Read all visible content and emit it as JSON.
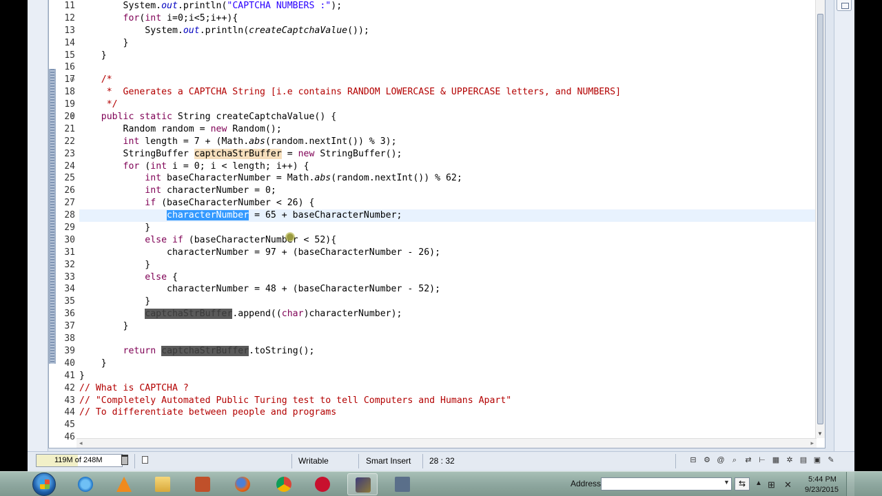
{
  "editor": {
    "lines": [
      {
        "n": "11",
        "fold": ""
      },
      {
        "n": "12",
        "fold": ""
      },
      {
        "n": "13",
        "fold": ""
      },
      {
        "n": "14",
        "fold": ""
      },
      {
        "n": "15",
        "fold": ""
      },
      {
        "n": "16",
        "fold": ""
      },
      {
        "n": "17",
        "fold": "⊖"
      },
      {
        "n": "18",
        "fold": ""
      },
      {
        "n": "19",
        "fold": ""
      },
      {
        "n": "20",
        "fold": "⊖"
      },
      {
        "n": "21",
        "fold": ""
      },
      {
        "n": "22",
        "fold": ""
      },
      {
        "n": "23",
        "fold": ""
      },
      {
        "n": "24",
        "fold": ""
      },
      {
        "n": "25",
        "fold": ""
      },
      {
        "n": "26",
        "fold": ""
      },
      {
        "n": "27",
        "fold": ""
      },
      {
        "n": "28",
        "fold": ""
      },
      {
        "n": "29",
        "fold": ""
      },
      {
        "n": "30",
        "fold": ""
      },
      {
        "n": "31",
        "fold": ""
      },
      {
        "n": "32",
        "fold": ""
      },
      {
        "n": "33",
        "fold": ""
      },
      {
        "n": "34",
        "fold": ""
      },
      {
        "n": "35",
        "fold": ""
      },
      {
        "n": "36",
        "fold": ""
      },
      {
        "n": "37",
        "fold": ""
      },
      {
        "n": "38",
        "fold": ""
      },
      {
        "n": "39",
        "fold": ""
      },
      {
        "n": "40",
        "fold": ""
      },
      {
        "n": "41",
        "fold": ""
      },
      {
        "n": "42",
        "fold": ""
      },
      {
        "n": "43",
        "fold": ""
      },
      {
        "n": "44",
        "fold": ""
      },
      {
        "n": "45",
        "fold": ""
      },
      {
        "n": "46",
        "fold": ""
      }
    ],
    "current_line": "28",
    "code": {
      "l11_a": "        System.",
      "l11_b": "out",
      "l11_c": ".println(",
      "l11_d": "\"CAPTCHA NUMBERS :\"",
      "l11_e": ");",
      "l12_a": "        ",
      "l12_kw": "for",
      "l12_b": "(",
      "l12_kw2": "int",
      "l12_c": " i=0;i<5;i++){",
      "l13_a": "            System.",
      "l13_b": "out",
      "l13_c": ".println(",
      "l13_d": "createCaptchaValue",
      "l13_e": "());",
      "l14": "        }",
      "l15": "    }",
      "l16": "",
      "l17": "    /*",
      "l18": "     *  Generates a CAPTCHA String [i.e contains RANDOM LOWERCASE & UPPERCASE letters, and NUMBERS]",
      "l19": "     */",
      "l20_a": "    ",
      "l20_kw": "public static",
      "l20_b": " String createCaptchaValue() {",
      "l21_a": "        Random random = ",
      "l21_kw": "new",
      "l21_b": " Random();",
      "l22_a": "        ",
      "l22_kw": "int",
      "l22_b": " length = 7 + (Math.",
      "l22_c": "abs",
      "l22_d": "(random.nextInt()) % 3);",
      "l23_a": "        StringBuffer ",
      "l23_occ": "captchaStrBuffer",
      "l23_b": " = ",
      "l23_kw": "new",
      "l23_c": " StringBuffer();",
      "l24_a": "        ",
      "l24_kw": "for",
      "l24_b": " (",
      "l24_kw2": "int",
      "l24_c": " i = 0; i < length; i++) {",
      "l25_a": "            ",
      "l25_kw": "int",
      "l25_b": " baseCharacterNumber = Math.",
      "l25_c": "abs",
      "l25_d": "(random.nextInt()) % 62;",
      "l26_a": "            ",
      "l26_kw": "int",
      "l26_b": " characterNumber = 0;",
      "l27_a": "            ",
      "l27_kw": "if",
      "l27_b": " (baseCharacterNumber < 26) {",
      "l28_a": "                ",
      "l28_sel": "characterNumber",
      "l28_b": " = 65 + baseCharacterNumber;",
      "l29": "            }",
      "l30_a": "            ",
      "l30_kw": "else if",
      "l30_b": " (baseCharacterNumber < 52){",
      "l31": "                characterNumber = 97 + (baseCharacterNumber - 26);",
      "l32": "            }",
      "l33_a": "            ",
      "l33_kw": "else",
      "l33_b": " {",
      "l34": "                characterNumber = 48 + (baseCharacterNumber - 52);",
      "l35": "            }",
      "l36_a": "            ",
      "l36_occ": "captchaStrBuffer",
      "l36_b": ".append((",
      "l36_kw": "char",
      "l36_c": ")characterNumber);",
      "l37": "        }",
      "l38": "",
      "l39_a": "        ",
      "l39_kw": "return",
      "l39_b": " ",
      "l39_occ": "captchaStrBuffer",
      "l39_c": ".toString();",
      "l40": "    }",
      "l41": "}",
      "l42": "// What is CAPTCHA ?",
      "l43": "// \"Completely Automated Public Turing test to tell Computers and Humans Apart\"",
      "l44": "// To differentiate between people and programs",
      "l45": "",
      "l46": ""
    }
  },
  "statusbar": {
    "heap": "119M of 248M",
    "heap_used_fraction": 0.48,
    "writable": "Writable",
    "insert_mode": "Smart Insert",
    "position": "28 : 32"
  },
  "taskbar": {
    "address_label": "Address",
    "address_value": "",
    "time": "5:44 PM",
    "date": "9/23/2015"
  },
  "colors": {
    "keyword": "#7f0055",
    "comment": "#b30000",
    "string": "#2a00ff",
    "selection": "#3399ff",
    "occurrence": "#f6dfbd"
  }
}
